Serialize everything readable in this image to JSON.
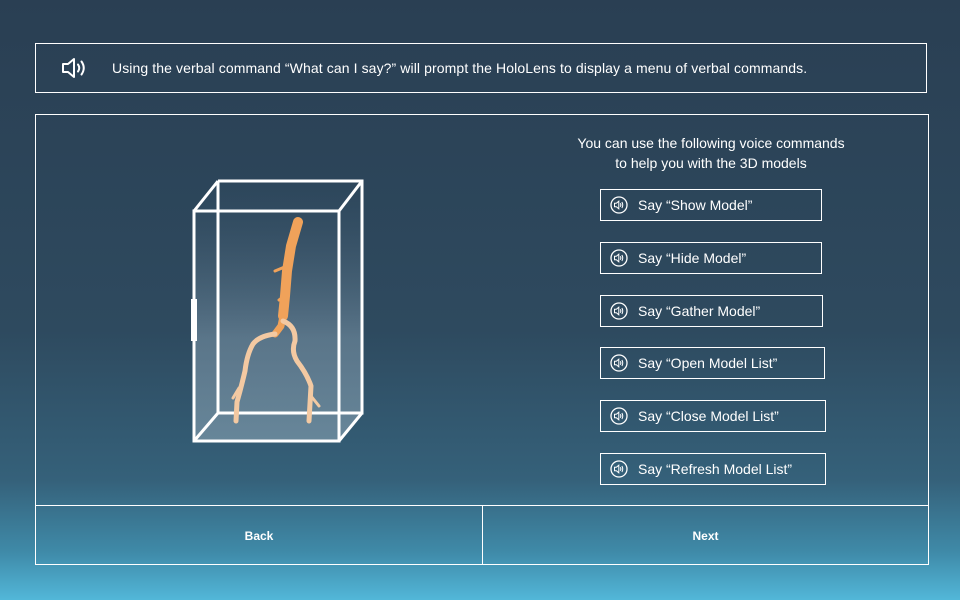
{
  "banner": {
    "icon": "speaker-icon",
    "text": "Using the verbal command “What can I say?” will prompt the HoloLens to display a menu of verbal commands."
  },
  "commands": {
    "header_line1": "You can use the following voice commands",
    "header_line2": "to help you with the 3D models",
    "icon": "speaker-circle-icon",
    "items": [
      {
        "label": "Say “Show Model”"
      },
      {
        "label": "Say “Hide Model”"
      },
      {
        "label": "Say “Gather Model”"
      },
      {
        "label": "Say “Open Model List”"
      },
      {
        "label": "Say “Close Model List”"
      },
      {
        "label": "Say “Refresh Model List”"
      }
    ]
  },
  "model": {
    "icon": "vessel-model-icon"
  },
  "footer": {
    "back_label": "Back",
    "next_label": "Next"
  },
  "colors": {
    "background_top": "#2a3f53",
    "background_bottom": "#52b7d8",
    "model": "#f0a25a",
    "outline": "#ffffff"
  }
}
